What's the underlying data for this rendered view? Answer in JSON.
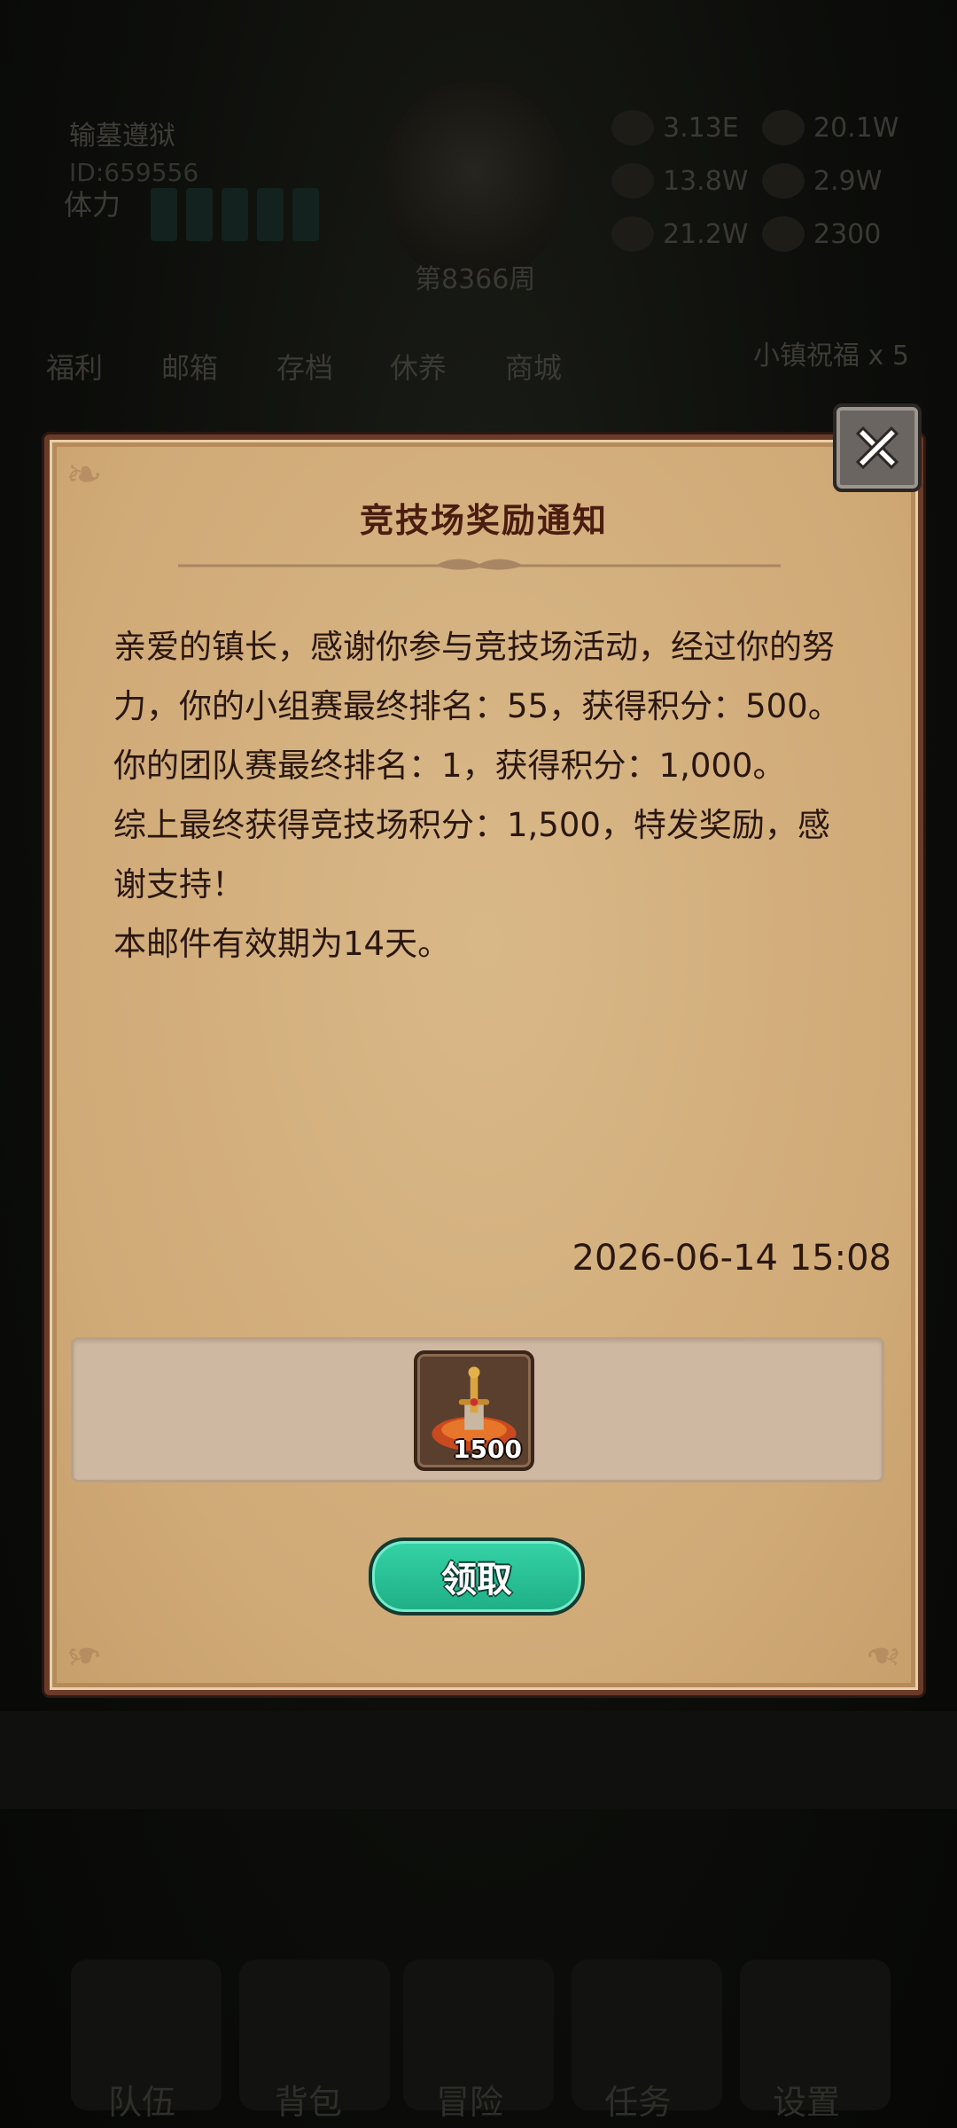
{
  "background": {
    "player_name": "输墓遵狱",
    "player_id": "ID:659556",
    "stamina_label": "体力",
    "week_label": "第8366周",
    "resources": [
      "3.13E",
      "20.1W",
      "13.8W",
      "2.9W",
      "21.2W",
      "2300"
    ],
    "nav_items": [
      "福利",
      "邮箱",
      "存档",
      "休养",
      "商城"
    ],
    "blessing": "小镇祝福 x 5",
    "bottom_tabs": [
      "队伍",
      "背包",
      "冒险",
      "任务",
      "设置"
    ]
  },
  "dialog": {
    "title": "竞技场奖励通知",
    "body_lines": [
      "亲爱的镇长，感谢你参与竞技场活动，经过你的努力，你的小组赛最终排名：55，获得积分：500。",
      "你的团队赛最终排名：1，获得积分：1,000。",
      "综上最终获得竞技场积分：1,500，特发奖励，感谢支持！",
      "本邮件有效期为14天。"
    ],
    "timestamp": "2026-06-14 15:08",
    "reward": {
      "icon": "arena-trophy-icon",
      "quantity": "1500"
    },
    "claim_label": "领取",
    "close_icon": "close-icon"
  },
  "colors": {
    "panel": "#d2ae7c",
    "border": "#6b3a28",
    "title": "#4a1d10",
    "claim_button": "#2fc89d"
  }
}
